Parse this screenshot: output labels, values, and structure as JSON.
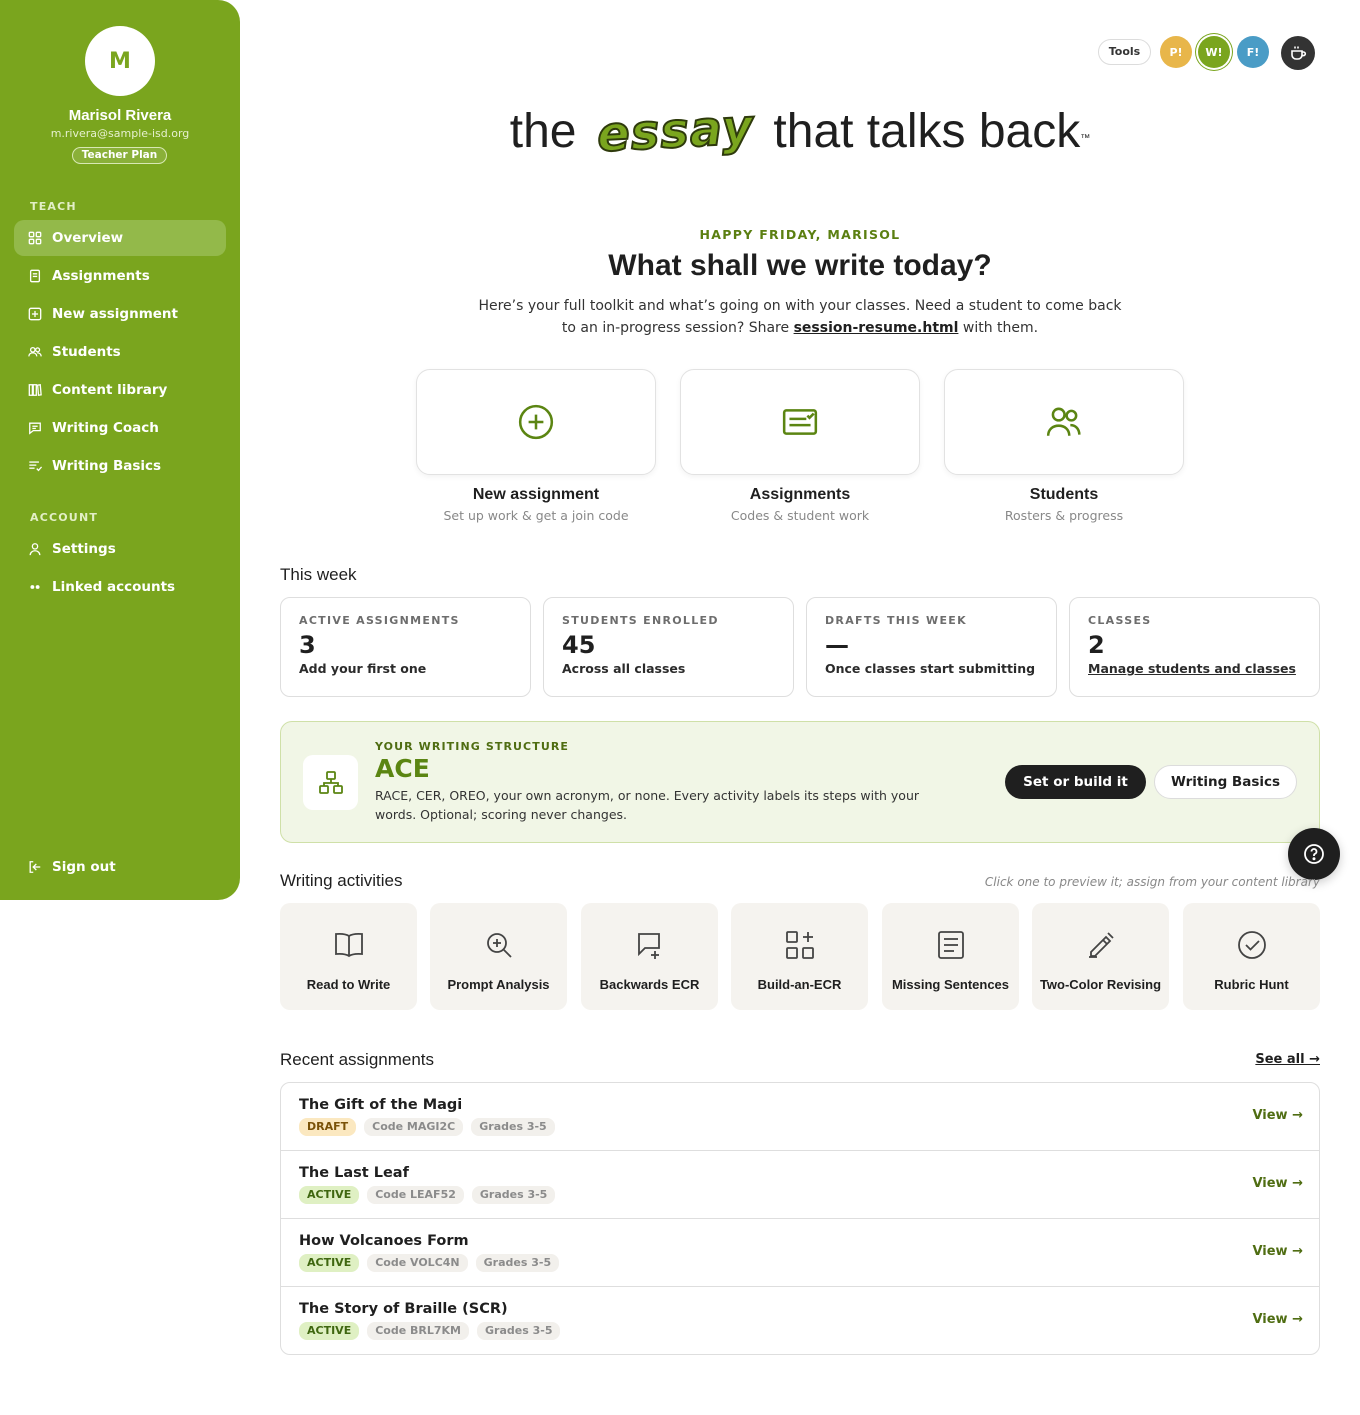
{
  "sidebar": {
    "avatar_initial": "M",
    "user_name": "Marisol Rivera",
    "user_email": "m.rivera@sample-isd.org",
    "plan": "Teacher Plan",
    "teach_label": "TEACH",
    "teach_items": [
      {
        "label": "Overview",
        "icon": "grid-icon",
        "active": true
      },
      {
        "label": "Assignments",
        "icon": "document-icon"
      },
      {
        "label": "New assignment",
        "icon": "plus-square-icon"
      },
      {
        "label": "Students",
        "icon": "users-icon"
      },
      {
        "label": "Content library",
        "icon": "library-icon"
      },
      {
        "label": "Writing Coach",
        "icon": "chat-icon"
      },
      {
        "label": "Writing Basics",
        "icon": "list-icon"
      }
    ],
    "account_label": "ACCOUNT",
    "account_items": [
      {
        "label": "Settings",
        "icon": "user-icon"
      },
      {
        "label": "Linked accounts",
        "icon": "link-icon"
      }
    ],
    "sign_out": "Sign out"
  },
  "topbar": {
    "tools": "Tools",
    "badges": [
      {
        "label": "P!",
        "color": "#e8b64a"
      },
      {
        "label": "W!",
        "color": "#7aa51e"
      },
      {
        "label": "F!",
        "color": "#4a9cc6"
      }
    ]
  },
  "hero": {
    "before": "the",
    "logo_word": "essay",
    "after": "that talks back",
    "tm": "™"
  },
  "welcome": {
    "greeting": "HAPPY FRIDAY, MARISOL",
    "headline": "What shall we write today?",
    "intro_1": "Here’s your full toolkit and what’s going on with your classes. Need a student to come back to an in-progress session? Share ",
    "intro_link": "session-resume.html",
    "intro_2": " with them."
  },
  "quick_actions": [
    {
      "title": "New assignment",
      "subtitle": "Set up work & get a join code",
      "icon": "plus-circle-icon"
    },
    {
      "title": "Assignments",
      "subtitle": "Codes & student work",
      "icon": "assignment-card-icon"
    },
    {
      "title": "Students",
      "subtitle": "Rosters & progress",
      "icon": "users-icon"
    }
  ],
  "this_week": {
    "title": "This week",
    "stats": [
      {
        "label": "ACTIVE ASSIGNMENTS",
        "value": "3",
        "sub": "Add your first one"
      },
      {
        "label": "STUDENTS ENROLLED",
        "value": "45",
        "sub": "Across all classes"
      },
      {
        "label": "DRAFTS THIS WEEK",
        "value": "—",
        "sub": "Once classes start submitting"
      },
      {
        "label": "CLASSES",
        "value": "2",
        "sub": "Manage students and classes"
      }
    ]
  },
  "structure": {
    "label": "YOUR WRITING STRUCTURE",
    "name": "ACE",
    "description": "RACE, CER, OREO, your own acronym, or none. Every activity labels its steps with your words. Optional; scoring never changes.",
    "primary_button": "Set or build it",
    "secondary_button": "Writing Basics"
  },
  "activities": {
    "title": "Writing activities",
    "hint": "Click one to preview it; assign from your content library",
    "items": [
      {
        "label": "Read to Write",
        "icon": "open-book-icon"
      },
      {
        "label": "Prompt Analysis",
        "icon": "zoom-in-icon"
      },
      {
        "label": "Backwards ECR",
        "icon": "message-plus-icon"
      },
      {
        "label": "Build-an-ECR",
        "icon": "blocks-icon"
      },
      {
        "label": "Missing Sentences",
        "icon": "text-document-icon"
      },
      {
        "label": "Two-Color Revising",
        "icon": "pencil-icon"
      },
      {
        "label": "Rubric Hunt",
        "icon": "check-circle-icon"
      }
    ]
  },
  "recent": {
    "title": "Recent assignments",
    "see_all": "See all →",
    "view_label": "View →",
    "rows": [
      {
        "title": "The Gift of the Magi",
        "status": "DRAFT",
        "code": "Code MAGI2C",
        "grades": "Grades 3-5"
      },
      {
        "title": "The Last Leaf",
        "status": "ACTIVE",
        "code": "Code LEAF52",
        "grades": "Grades 3-5"
      },
      {
        "title": "How Volcanoes Form",
        "status": "ACTIVE",
        "code": "Code VOLC4N",
        "grades": "Grades 3-5"
      },
      {
        "title": "The Story of Braille (SCR)",
        "status": "ACTIVE",
        "code": "Code BRL7KM",
        "grades": "Grades 3-5"
      }
    ]
  },
  "colors": {
    "brand_green": "#7aa51e",
    "dark": "#1f1f1f",
    "structure_bg": "#f1f6e6"
  }
}
